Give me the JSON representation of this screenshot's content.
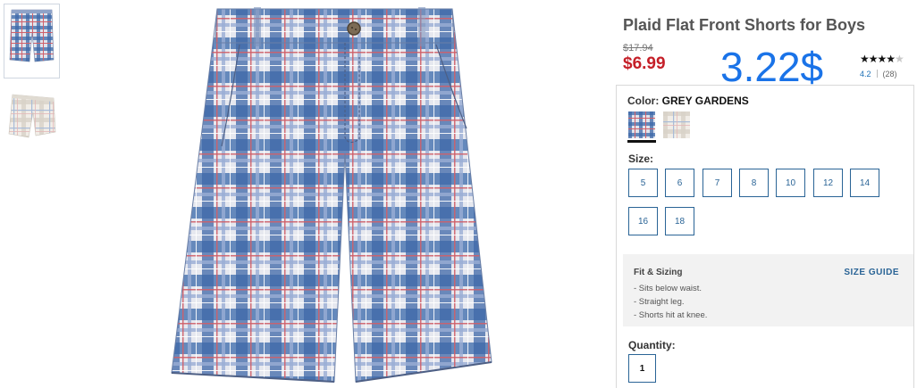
{
  "product": {
    "title": "Plaid Flat Front Shorts for Boys",
    "original_price": "$17.94",
    "sale_price": "$6.99",
    "overlay_price": "3.22$"
  },
  "rating": {
    "stars_filled": "★★★★",
    "stars_empty": "★",
    "average": "4.2",
    "count": "(28)",
    "value": 4.2
  },
  "color": {
    "label": "Color:",
    "selected_name": "GREY GARDENS",
    "swatches": [
      "blue-plaid",
      "grey-gardens"
    ]
  },
  "size": {
    "label": "Size:",
    "options": [
      "5",
      "6",
      "7",
      "8",
      "10",
      "12",
      "14",
      "16",
      "18"
    ]
  },
  "fit": {
    "title": "Fit & Sizing",
    "size_guide": "SIZE GUIDE",
    "bullets": [
      "- Sits below waist.",
      "- Straight leg.",
      "- Shorts hit at knee."
    ]
  },
  "quantity": {
    "label": "Quantity:",
    "value": "1"
  },
  "colors": {
    "sale_red": "#c51f28",
    "overlay_blue": "#1a73e8",
    "link_blue": "#2a6496"
  }
}
